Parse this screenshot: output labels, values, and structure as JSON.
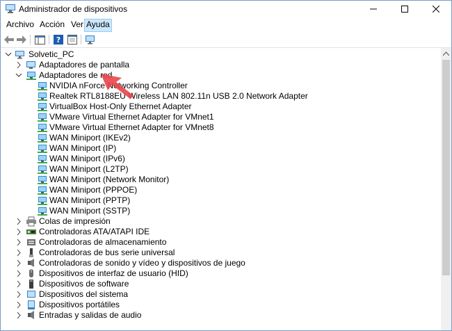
{
  "window": {
    "title": "Administrador de dispositivos"
  },
  "menu": [
    "Archivo",
    "Acción",
    "Ver",
    "Ayuda"
  ],
  "menu_active_index": 3,
  "tree": {
    "root": "Solvetic_PC",
    "categories": [
      {
        "label": "Adaptadores de pantalla",
        "icon": "display-adapter-icon",
        "expanded": false
      },
      {
        "label": "Adaptadores de red",
        "icon": "network-adapter-icon",
        "expanded": true,
        "children": [
          "NVIDIA nForce Networking Controller",
          "Realtek RTL8188EU Wireless LAN 802.11n USB 2.0 Network Adapter",
          "VirtualBox Host-Only Ethernet Adapter",
          "VMware Virtual Ethernet Adapter for VMnet1",
          "VMware Virtual Ethernet Adapter for VMnet8",
          "WAN Miniport (IKEv2)",
          "WAN Miniport (IP)",
          "WAN Miniport (IPv6)",
          "WAN Miniport (L2TP)",
          "WAN Miniport (Network Monitor)",
          "WAN Miniport (PPPOE)",
          "WAN Miniport (PPTP)",
          "WAN Miniport (SSTP)"
        ]
      },
      {
        "label": "Colas de impresión",
        "icon": "print-queue-icon",
        "expanded": false
      },
      {
        "label": "Controladoras ATA/ATAPI IDE",
        "icon": "ide-controller-icon",
        "expanded": false
      },
      {
        "label": "Controladoras de almacenamiento",
        "icon": "storage-controller-icon",
        "expanded": false
      },
      {
        "label": "Controladoras de bus serie universal",
        "icon": "usb-controller-icon",
        "expanded": false
      },
      {
        "label": "Controladoras de sonido y vídeo y dispositivos de juego",
        "icon": "sound-icon",
        "expanded": false
      },
      {
        "label": "Dispositivos de interfaz de usuario (HID)",
        "icon": "hid-icon",
        "expanded": false
      },
      {
        "label": "Dispositivos de software",
        "icon": "software-device-icon",
        "expanded": false
      },
      {
        "label": "Dispositivos del sistema",
        "icon": "system-device-icon",
        "expanded": false
      },
      {
        "label": "Dispositivos portátiles",
        "icon": "portable-device-icon",
        "expanded": false
      },
      {
        "label": "Entradas y salidas de audio",
        "icon": "audio-io-icon",
        "expanded": false
      }
    ]
  },
  "colors": {
    "menu_active_bg": "#cce8ff",
    "menu_active_border": "#99c9ef",
    "arrow": "#e8454a",
    "network_icon": "#2d8bd6"
  }
}
